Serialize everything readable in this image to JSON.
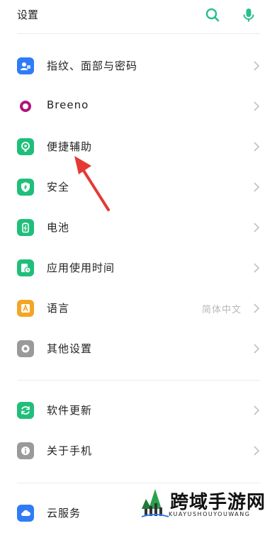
{
  "header": {
    "title": "设置",
    "icons": [
      "search-icon",
      "mic-icon"
    ],
    "accent": "#27c08a"
  },
  "groups": [
    {
      "items": [
        {
          "label": "指纹、面部与密码",
          "icon": "fingerprint-face-icon",
          "color": "#2f7cf6"
        },
        {
          "label": "Breeno",
          "icon": "breeno-icon",
          "color": "#b0157d"
        },
        {
          "label": "便捷辅助",
          "icon": "assist-icon",
          "color": "#1fbf7a"
        },
        {
          "label": "安全",
          "icon": "shield-icon",
          "color": "#1fbf7a"
        },
        {
          "label": "电池",
          "icon": "battery-icon",
          "color": "#1fbf7a"
        },
        {
          "label": "应用使用时间",
          "icon": "app-time-icon",
          "color": "#1fbf7a"
        },
        {
          "label": "语言",
          "icon": "language-icon",
          "color": "#f5a524",
          "value": "简体中文"
        },
        {
          "label": "其他设置",
          "icon": "other-settings-icon",
          "color": "#9a9a9a"
        }
      ]
    },
    {
      "items": [
        {
          "label": "软件更新",
          "icon": "update-icon",
          "color": "#1fbf7a"
        },
        {
          "label": "关于手机",
          "icon": "info-icon",
          "color": "#9a9a9a"
        }
      ]
    },
    {
      "items": [
        {
          "label": "云服务",
          "icon": "cloud-icon",
          "color": "#2f7cf6"
        }
      ]
    }
  ],
  "annotation": {
    "arrow_color": "#e53935",
    "points_to": "便捷辅助"
  },
  "watermark": {
    "title": "跨域手游网",
    "subtitle": "KUAYUSHOUYOUWANG"
  }
}
